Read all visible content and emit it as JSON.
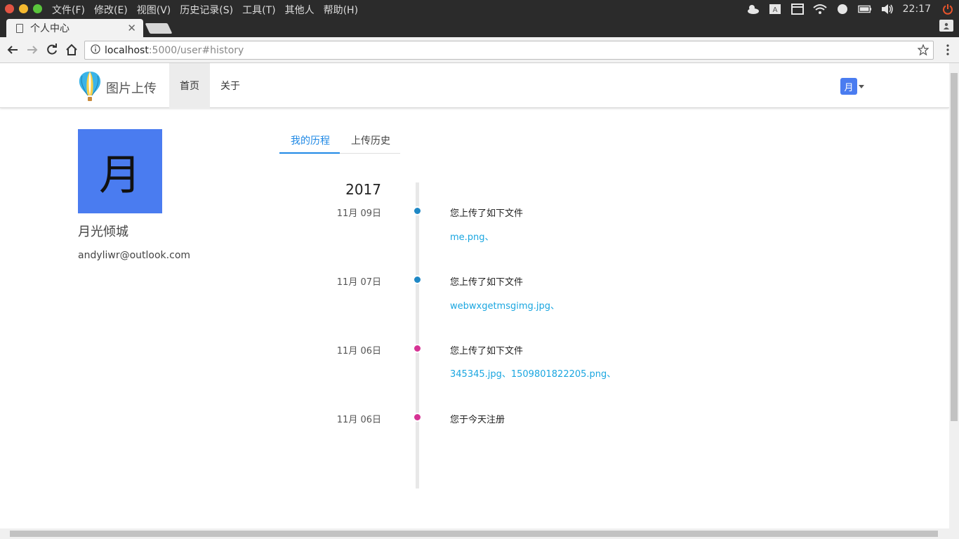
{
  "os": {
    "menu": [
      "文件(F)",
      "修改(E)",
      "视图(V)",
      "历史记录(S)",
      "工具(T)",
      "其他人",
      "帮助(H)"
    ],
    "clock": "22:17"
  },
  "browser": {
    "tab_title": "个人中心",
    "url_host": "localhost",
    "url_rest": ":5000/user#history"
  },
  "site": {
    "brand": "图片上传",
    "nav": [
      "首页",
      "关于"
    ],
    "user_initial": "月"
  },
  "profile": {
    "avatar_char": "月",
    "name": "月光倾城",
    "email": "andyliwr@outlook.com"
  },
  "tabs": [
    "我的历程",
    "上传历史"
  ],
  "timeline": {
    "year": "2017",
    "entries": [
      {
        "date": "11月 09日",
        "title": "您上传了如下文件",
        "files": "me.png、",
        "dot_color": "#1f88c5"
      },
      {
        "date": "11月 07日",
        "title": "您上传了如下文件",
        "files": "webwxgetmsgimg.jpg、",
        "dot_color": "#1f88c5"
      },
      {
        "date": "11月 06日",
        "title": "您上传了如下文件",
        "files": "345345.jpg、1509801822205.png、",
        "dot_color": "#d63394"
      },
      {
        "date": "11月 06日",
        "title": "您于今天注册",
        "files": "",
        "dot_color": "#d63394"
      }
    ]
  }
}
